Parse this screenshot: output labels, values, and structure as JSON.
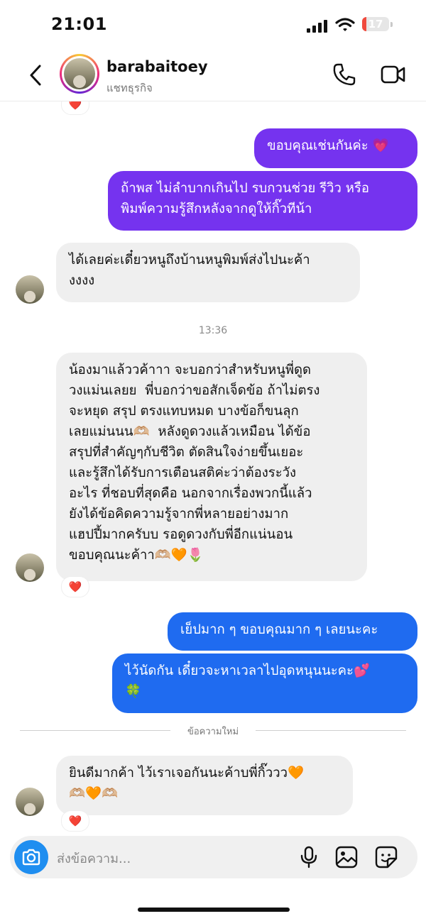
{
  "status_bar": {
    "time": "21:01",
    "battery": "17",
    "battery_level": 0.17
  },
  "header": {
    "name": "barabaitoey",
    "subtitle": "แชทธุรกิจ"
  },
  "messages": [
    {
      "text": "ขอบคุณเช่นกันค่ะ 💗"
    },
    {
      "text": "ถ้าพส ไม่ลำบากเกินไป รบกวนช่วย รีวิว หรือ\nพิมพ์ความรู้สึกหลังจากดูให้กิ๊วทีน้า"
    },
    {
      "text": "ได้เลยค่ะเดี๋ยวหนูถึงบ้านหนูพิมพ์ส่งไปนะค้า\nงงงง"
    },
    {
      "text": "น้องมาแล้ววค้าาา จะบอกว่าสำหรับหนูพี่ดูด\nวงแม่นเลยย  พี่บอกว่าขอสักเจ็ดข้อ ถ้าไม่ตรง\nจะหยุด สรุป ตรงแทบหมด บางข้อก็ขนลุก\nเลยแม่นนน🫶🏼  หลังดูดวงแล้วเหมือน ได้ข้อ\nสรุปที่สำคัญๆกับชีวิต ตัดสินใจง่ายขึ้นเยอะ\nและรู้สึกได้รับการเตือนสติค่ะว่าต้องระวัง\nอะไร ที่ชอบที่สุดคือ นอกจากเรื่องพวกนี้แล้ว\nยังได้ข้อคิดความรู้จากพี่หลายอย่างมาก\nแฮปปี้มากครับบ รอดูดวงกับพี่อีกแน่นอน\nขอบคุณนะค้าา🫶🏼🧡🌷"
    },
    {
      "text": "เย็ปมาก ๆ ขอบคุณมาก ๆ เลยนะคะ"
    },
    {
      "text": "ไว้นัดกัน เดี๋ยวจะหาเวลาไปอุดหนุนนะคะ💕\n🍀"
    },
    {
      "text": "ยินดีมากค้า ไว้เราเจอกันนะค้าบพี่กิ๊ววว🧡\n🫶🏼🧡🫶🏼"
    }
  ],
  "timestamp": "13:36",
  "new_messages_divider": "ข้อความใหม่",
  "reaction": "❤️",
  "composer": {
    "placeholder": "ส่งข้อความ..."
  },
  "colors": {
    "outgoing_purple": "#7533ef",
    "outgoing_blue": "#1f6bf0",
    "incoming": "#efefef",
    "camera_button": "#1f8ef0"
  }
}
